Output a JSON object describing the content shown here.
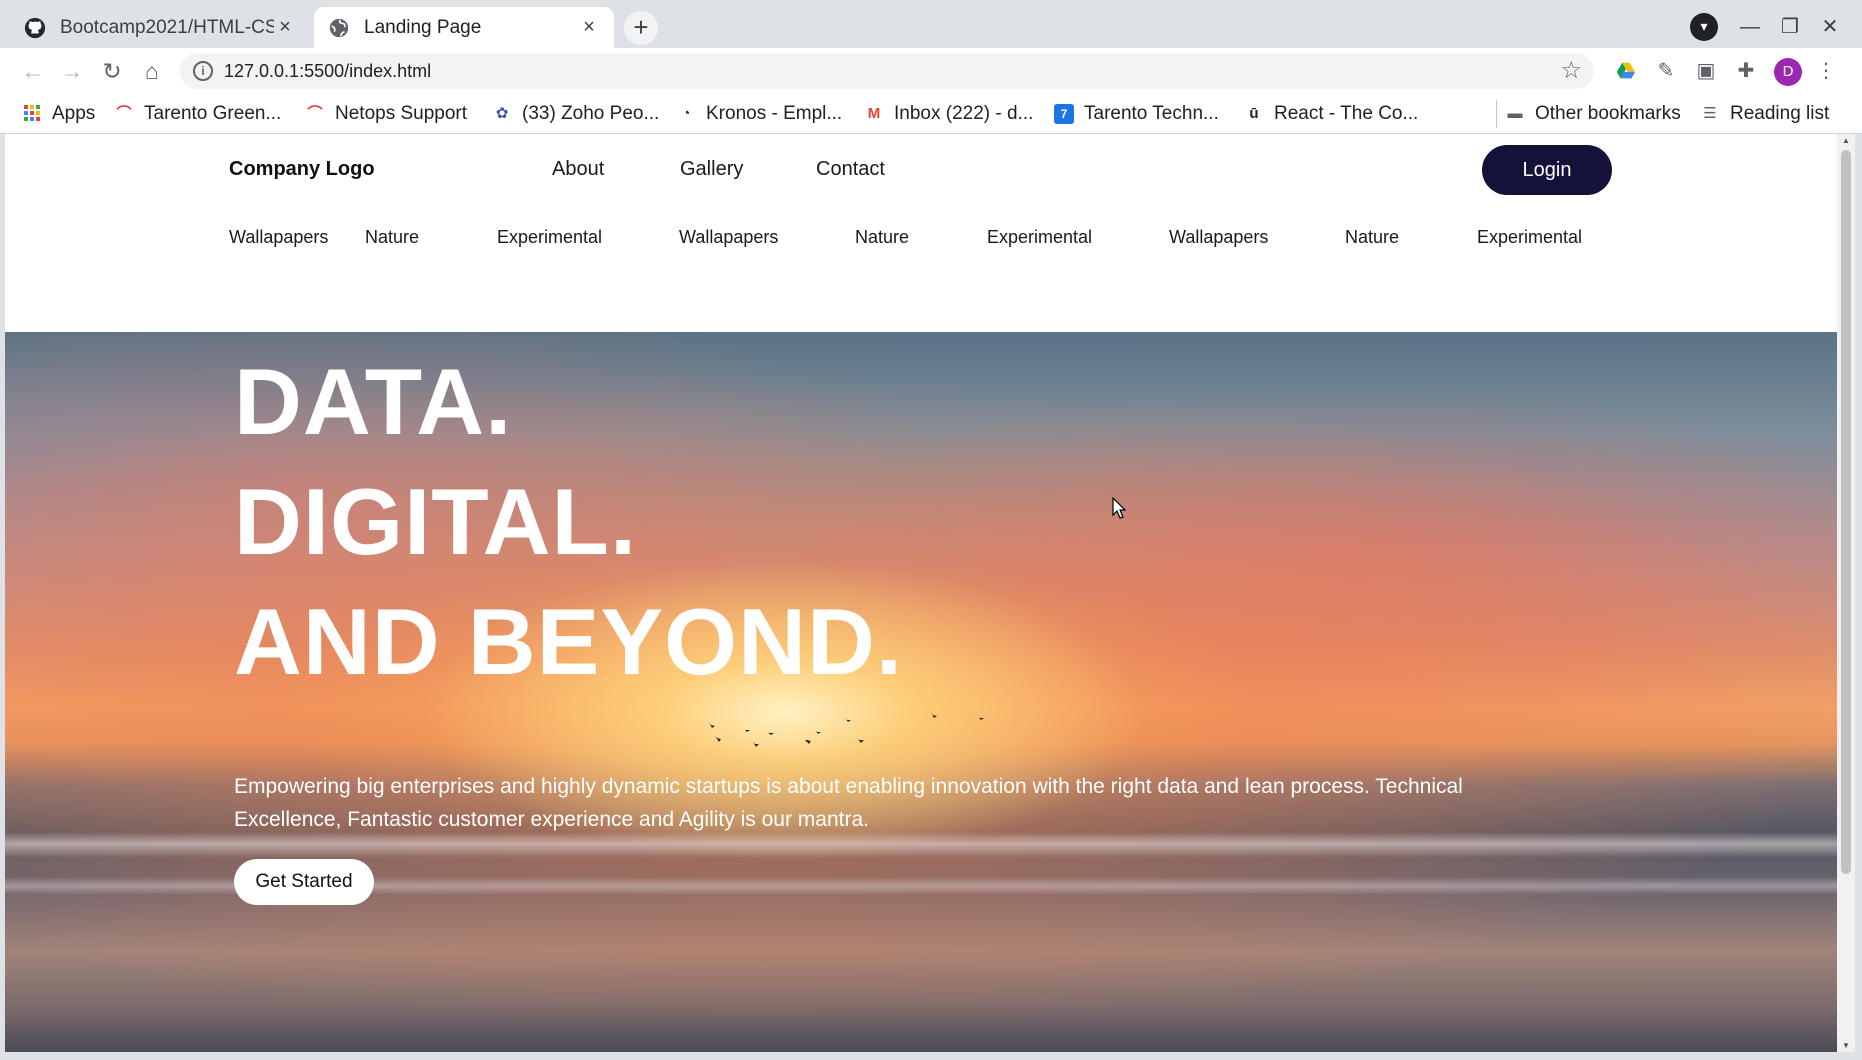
{
  "browser": {
    "tabs": [
      {
        "title": "Bootcamp2021/HTML-CS",
        "active": false,
        "icon": "github-icon"
      },
      {
        "title": "Landing Page",
        "active": true,
        "icon": "globe-icon"
      }
    ],
    "close_glyph": "×",
    "new_tab_glyph": "+",
    "url": "127.0.0.1:5500/index.html",
    "profile_initial": "D",
    "bookmarks": [
      {
        "label": "Apps",
        "icon": "apps-grid-icon"
      },
      {
        "label": "Tarento Green...",
        "icon": "tarento-icon"
      },
      {
        "label": "Netops Support",
        "icon": "tarento-icon"
      },
      {
        "label": "(33) Zoho Peo...",
        "icon": "zoho-icon"
      },
      {
        "label": "Kronos - Empl...",
        "icon": "kronos-icon"
      },
      {
        "label": "Inbox (222) - d...",
        "icon": "gmail-icon"
      },
      {
        "label": "Tarento Techn...",
        "icon": "calendar-icon"
      },
      {
        "label": "React - The Co...",
        "icon": "udemy-icon"
      }
    ],
    "other_bookmarks": "Other bookmarks",
    "reading_list": "Reading list"
  },
  "site": {
    "logo": "Company Logo",
    "nav": [
      "About",
      "Gallery",
      "Contact"
    ],
    "login": "Login",
    "subnav": [
      "Wallapapers",
      "Nature",
      "Experimental",
      "Wallapapers",
      "Nature",
      "Experimental",
      "Wallapapers",
      "Nature",
      "Experimental"
    ]
  },
  "hero": {
    "headline": [
      "DATA.",
      "DIGITAL.",
      "AND BEYOND."
    ],
    "tagline": "Empowering big enterprises and highly dynamic startups is about enabling innovation with the right data and lean process. Technical Excellence, Fantastic customer experience and Agility is our mantra.",
    "cta": "Get Started"
  },
  "colors": {
    "login_bg": "#14113a",
    "chrome_bg": "#dee1e6",
    "profile_bg": "#9c27b0"
  }
}
